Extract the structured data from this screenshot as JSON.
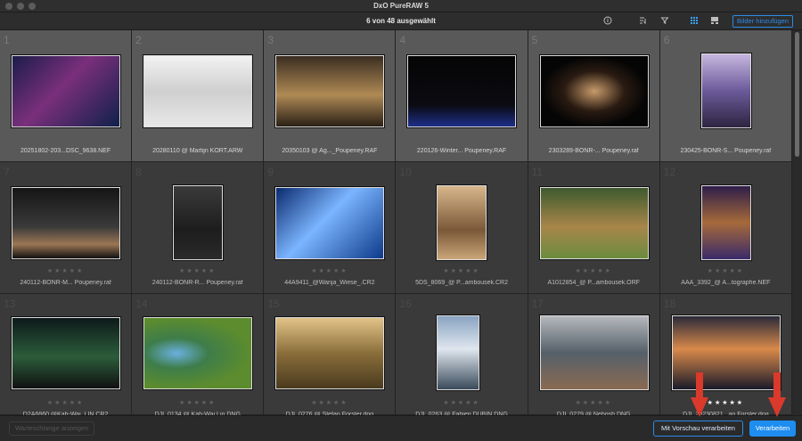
{
  "window": {
    "title": "DxO PureRAW 5"
  },
  "toolbar": {
    "selection_text": "6 von 48 ausgewählt",
    "info_icon": "info-icon",
    "sort_icon": "sort-icon",
    "filter_icon": "filter-icon",
    "grid_view_icon": "grid-view-icon",
    "single_view_icon": "single-view-icon",
    "add_images_label": "Bilder hinzufügen"
  },
  "images": [
    {
      "num": "1",
      "name": "20251802-203...DSC_9638.NEF",
      "selected": true,
      "stars": 0
    },
    {
      "num": "2",
      "name": "20280110 @ Martijn KORT.ARW",
      "selected": true,
      "stars": 0
    },
    {
      "num": "3",
      "name": "20350103 @ Ag..._Poupeney.RAF",
      "selected": true,
      "stars": 0
    },
    {
      "num": "4",
      "name": "220126-Winter... Poupeney.RAF",
      "selected": true,
      "stars": 0
    },
    {
      "num": "5",
      "name": "2303289-BONR-... Poupeney.raf",
      "selected": true,
      "stars": 0
    },
    {
      "num": "6",
      "name": "230425-BONR-S... Poupeney.raf",
      "selected": true,
      "stars": 0
    },
    {
      "num": "7",
      "name": "240112-BONR-M... Poupeney.raf",
      "selected": false,
      "stars": 0
    },
    {
      "num": "8",
      "name": "240112-BONR-R... Poupeney.raf",
      "selected": false,
      "stars": 0
    },
    {
      "num": "9",
      "name": "44A9411_@Wanja_Wiese_.CR2",
      "selected": false,
      "stars": 0
    },
    {
      "num": "10",
      "name": "5DS_8069_@ P...ambousek.CR2",
      "selected": false,
      "stars": 0
    },
    {
      "num": "11",
      "name": "A1012854_@ P...ambousek.ORF",
      "selected": false,
      "stars": 0
    },
    {
      "num": "12",
      "name": "AAA_3392_@ A...tographe.NEF",
      "selected": false,
      "stars": 0
    },
    {
      "num": "13",
      "name": "D2A6860 @Kah-Wai_LIN.CR2",
      "selected": false,
      "stars": 0
    },
    {
      "num": "14",
      "name": "DJI_0134 @ Kah-Wai Lin.DNG",
      "selected": false,
      "stars": 0
    },
    {
      "num": "15",
      "name": "DJI_0276 @ Stefan Forster.dng",
      "selected": false,
      "stars": 0
    },
    {
      "num": "16",
      "name": "DJI_0263 @ Fabien DUBIN.DNG",
      "selected": false,
      "stars": 0
    },
    {
      "num": "17",
      "name": "DJI_0279 @ Nebosh.DNG",
      "selected": false,
      "stars": 0
    },
    {
      "num": "18",
      "name": "DJI_20230821...an Forster.dng",
      "selected": false,
      "stars": 5
    }
  ],
  "bottom": {
    "queue_label": "Warteschlange anzeigen",
    "preview_label": "Mit Vorschau verarbeiten",
    "process_label": "Verarbeiten"
  },
  "colors": {
    "accent": "#1e8df0",
    "arrow": "#d93a2b",
    "selected_bg": "#595959"
  }
}
